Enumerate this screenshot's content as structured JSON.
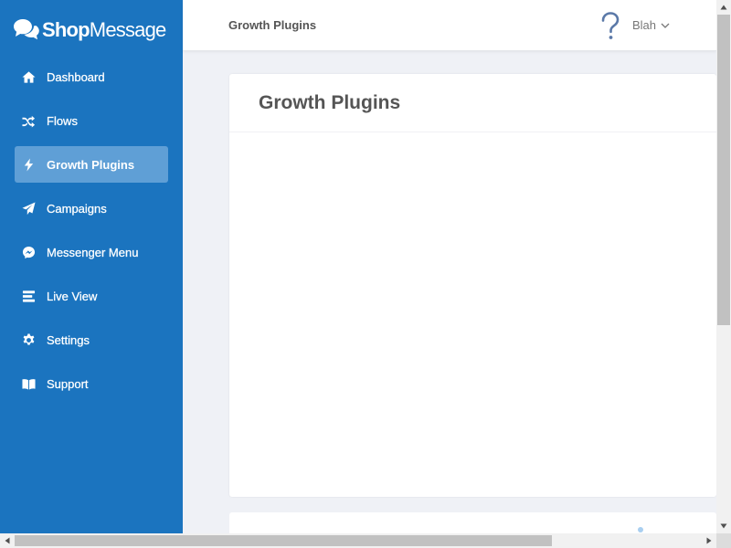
{
  "brand": {
    "name_bold": "Shop",
    "name_rest": "Message",
    "color": "#1b74bf"
  },
  "sidebar": {
    "items": [
      {
        "label": "Dashboard",
        "icon": "home-icon",
        "active": false
      },
      {
        "label": "Flows",
        "icon": "shuffle-icon",
        "active": false
      },
      {
        "label": "Growth Plugins",
        "icon": "bolt-icon",
        "active": true
      },
      {
        "label": "Campaigns",
        "icon": "paper-plane-icon",
        "active": false
      },
      {
        "label": "Messenger Menu",
        "icon": "messenger-icon",
        "active": false
      },
      {
        "label": "Live View",
        "icon": "list-icon",
        "active": false
      },
      {
        "label": "Settings",
        "icon": "gear-icon",
        "active": false
      },
      {
        "label": "Support",
        "icon": "book-icon",
        "active": false
      }
    ]
  },
  "header": {
    "title": "Growth Plugins",
    "help_icon": "question-mark-icon",
    "user_name": "Blah"
  },
  "main": {
    "card_title": "Growth Plugins"
  }
}
